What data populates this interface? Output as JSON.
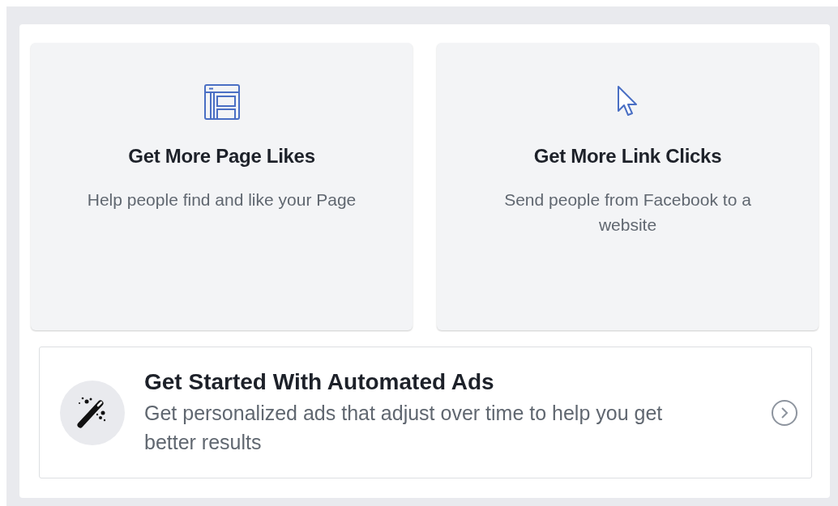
{
  "objectives": [
    {
      "kind": "page",
      "title": "Get More Page Likes",
      "description": "Help people find and like your Page"
    },
    {
      "kind": "cursor",
      "title": "Get More Link Clicks",
      "description": "Send people from Facebook to a website"
    }
  ],
  "automated_ads": {
    "title": "Get Started With Automated Ads",
    "description": "Get personalized ads that adjust over time to help you get better results"
  }
}
